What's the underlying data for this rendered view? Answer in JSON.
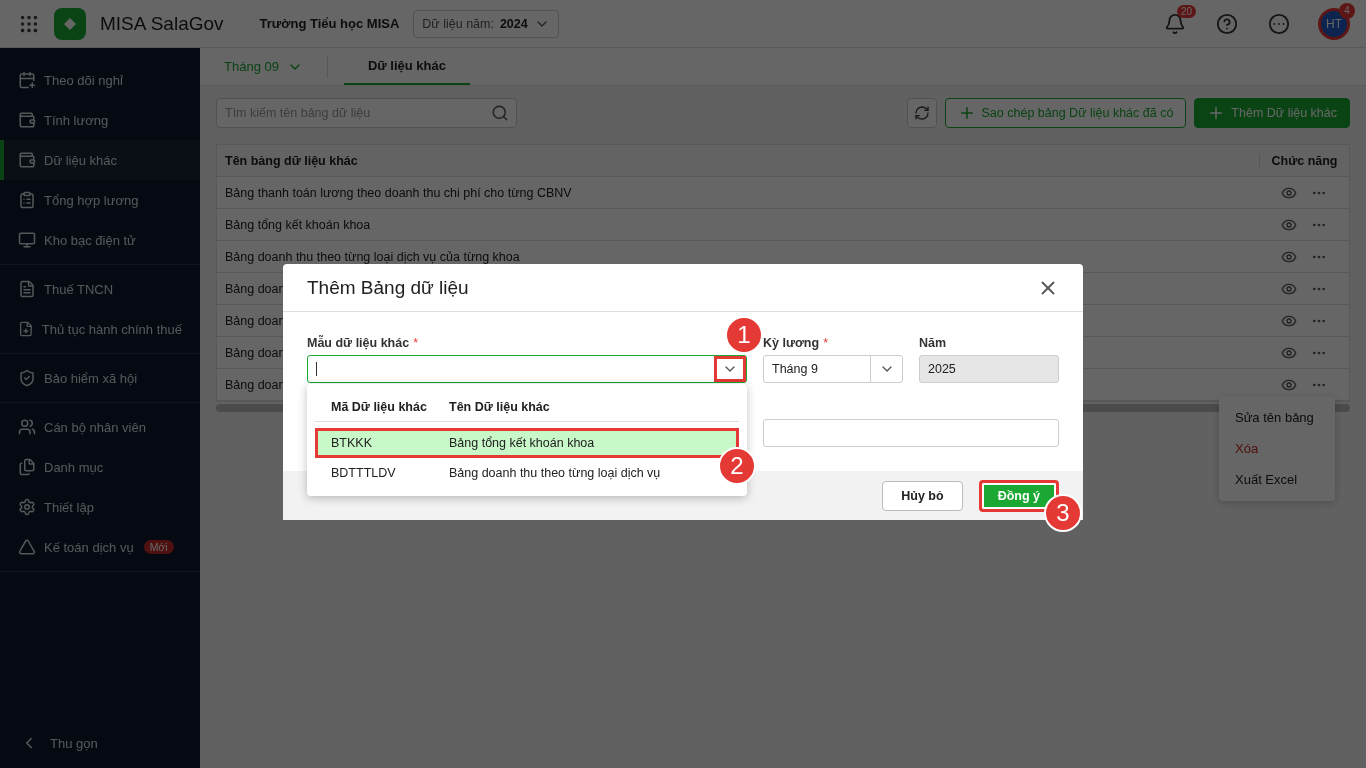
{
  "header": {
    "app_name": "MISA SalaGov",
    "organization": "Trường Tiểu học MISA",
    "year_picker": {
      "label": "Dữ liệu năm:",
      "value": "2024"
    },
    "notifications_badge": "20",
    "avatar": {
      "initials": "HT",
      "badge": "4"
    }
  },
  "sidebar": {
    "groups": [
      {
        "items": [
          {
            "label": "Theo dõi nghỉ",
            "selected": false
          },
          {
            "label": "Tính lương",
            "selected": false
          },
          {
            "label": "Dữ liệu khác",
            "selected": true
          },
          {
            "label": "Tổng hợp lương",
            "selected": false
          },
          {
            "label": "Kho bạc điện tử",
            "selected": false
          }
        ]
      },
      {
        "items": [
          {
            "label": "Thuế TNCN",
            "selected": false
          },
          {
            "label": "Thủ tục hành chính thuế",
            "selected": false
          }
        ]
      },
      {
        "items": [
          {
            "label": "Bảo hiểm xã hội",
            "selected": false
          }
        ]
      },
      {
        "items": [
          {
            "label": "Cán bộ nhân viên",
            "selected": false
          },
          {
            "label": "Danh mục",
            "selected": false
          },
          {
            "label": "Thiết lập",
            "selected": false
          },
          {
            "label": "Kế toán dịch vụ",
            "selected": false,
            "badge": "Mới"
          }
        ]
      }
    ],
    "collapse_label": "Thu gọn"
  },
  "tabs": [
    {
      "label": "Tháng 09",
      "kind": "dropdown",
      "selected": false
    },
    {
      "label": "Dữ liệu khác",
      "kind": "tab",
      "selected": true
    }
  ],
  "toolbar": {
    "search_placeholder": "Tìm kiếm tên bảng dữ liệu",
    "copy_button": "Sao chép bảng Dữ liệu khác đã có",
    "add_button": "Thêm Dữ liệu khác"
  },
  "table": {
    "columns": [
      "Tên bảng dữ liệu khác",
      "Chức năng"
    ],
    "rows": [
      {
        "name": "Bảng thanh toán lương theo doanh thu chi phí cho từng CBNV"
      },
      {
        "name": "Bảng tổng kết khoán khoa"
      },
      {
        "name": "Bảng doanh thu theo từng loại dịch vụ của từng khoa"
      },
      {
        "name": "Bảng doan"
      },
      {
        "name": "Bảng doan"
      },
      {
        "name": "Bảng doan"
      },
      {
        "name": "Bảng doan"
      }
    ]
  },
  "context_menu": [
    {
      "label": "Sửa tên bảng",
      "kind": "normal"
    },
    {
      "label": "Xóa",
      "kind": "danger"
    },
    {
      "label": "Xuất Excel",
      "kind": "normal"
    }
  ],
  "dialog": {
    "title": "Thêm Bảng dữ liệu",
    "fields": [
      {
        "label": "Mẫu dữ liệu khác",
        "required_mark": "*",
        "kind": "combo",
        "focused": true
      },
      {
        "label": "Kỳ lương",
        "required_mark": "*",
        "kind": "select",
        "value": "Tháng 9"
      },
      {
        "label": "Năm",
        "kind": "readonly",
        "value": "2025"
      },
      {
        "kind": "text"
      }
    ],
    "dropdown": {
      "columns": [
        "Mã Dữ liệu khác",
        "Tên Dữ liệu khác"
      ],
      "rows": [
        {
          "code": "BTKKK",
          "name": "Bảng tổng kết khoán khoa",
          "selected": true
        },
        {
          "code": "BDTTTLDV",
          "name": "Bảng doanh thu theo từng loại dịch vụ",
          "selected": false
        }
      ]
    },
    "buttons": [
      {
        "label": "Hủy bỏ",
        "kind": "secondary"
      },
      {
        "label": "Đồng ý",
        "kind": "primary"
      }
    ]
  },
  "annotations": [
    {
      "label": "1",
      "kind": "toggle"
    },
    {
      "label": "2",
      "kind": "option"
    },
    {
      "label": "3",
      "kind": "confirm"
    }
  ]
}
